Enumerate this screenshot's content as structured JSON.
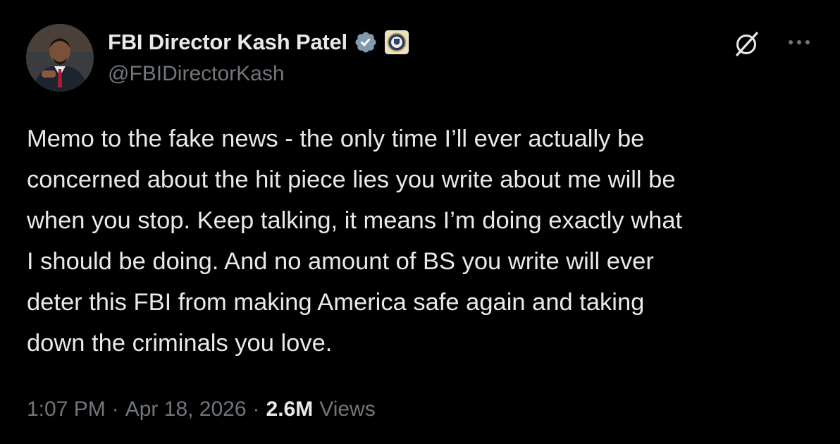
{
  "author": {
    "display_name": "FBI Director Kash Patel",
    "handle": "@FBIDirectorKash",
    "verified_badge_icon": "verified-check-icon",
    "verified_badge_color": "#829aab",
    "affiliation_badge_icon": "fbi-seal-icon"
  },
  "header_actions": {
    "grok_icon": "grok-icon",
    "more_icon": "more-options-icon"
  },
  "tweet": {
    "text": "Memo to the fake news - the only time I’ll ever actually be\nconcerned about the hit piece lies you write about me will be\nwhen you stop. Keep talking, it means I’m doing exactly what\nI should be doing. And no amount of BS you write will ever\ndeter this FBI from making America safe again and taking\ndown the criminals you love."
  },
  "meta": {
    "time": "1:07 PM",
    "separator": "·",
    "date": "Apr 18, 2026",
    "views_count": "2.6M",
    "views_label": "Views"
  },
  "colors": {
    "background": "#000000",
    "primary_text": "#e7e9ea",
    "secondary_text": "#71767b"
  }
}
